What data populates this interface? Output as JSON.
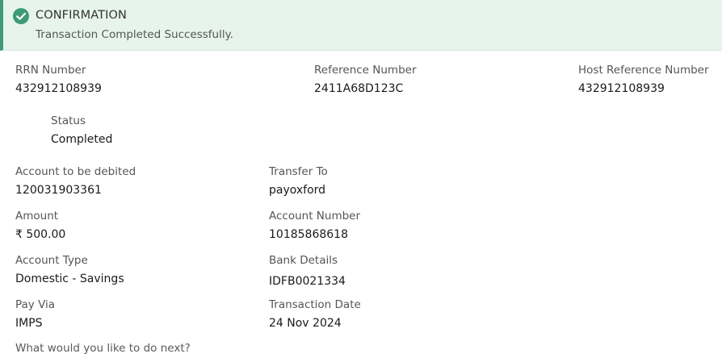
{
  "confirmation": {
    "title": "CONFIRMATION",
    "message": "Transaction Completed Successfully.",
    "icon": "check-circle-icon",
    "accent": "#3d9a78",
    "background": "#e7f4ec"
  },
  "reference": {
    "rrn_label": "RRN Number",
    "rrn_value": "432912108939",
    "ref_label": "Reference Number",
    "ref_value": "2411A68D123C",
    "host_label": "Host Reference Number",
    "host_value": "432912108939"
  },
  "status": {
    "label": "Status",
    "value": "Completed"
  },
  "details": {
    "debit_label": "Account to be debited",
    "debit_value": "120031903361",
    "transfer_label": "Transfer To",
    "transfer_value": "payoxford",
    "amount_label": "Amount",
    "amount_value": "₹ 500.00",
    "acct_num_label": "Account Number",
    "acct_num_value": "10185868618",
    "acct_type_label": "Account Type",
    "acct_type_value": "Domestic - Savings",
    "bank_label": "Bank Details",
    "bank_value": "IDFB0021334",
    "pay_via_label": "Pay Via",
    "pay_via_value": "IMPS",
    "date_label": "Transaction Date",
    "date_value": "24 Nov 2024"
  },
  "next": {
    "prompt": "What would you like to do next?"
  }
}
